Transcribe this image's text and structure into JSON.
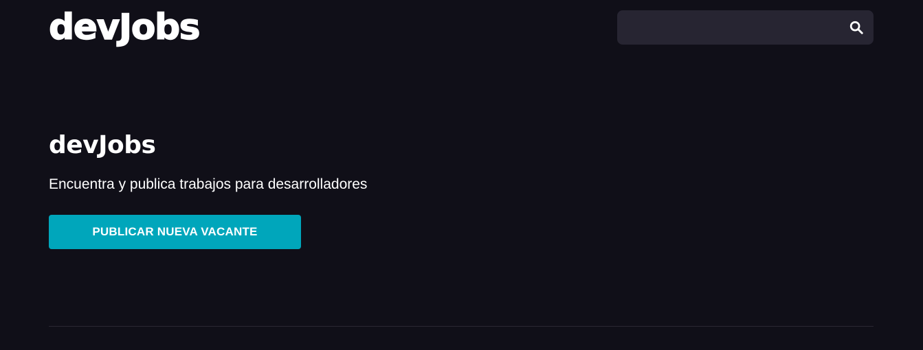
{
  "header": {
    "logo": "devJobs",
    "search": {
      "placeholder": "",
      "value": "",
      "icon": "search-icon"
    }
  },
  "hero": {
    "title": "devJobs",
    "subtitle": "Encuentra y publica trabajos para desarrolladores",
    "cta_label": "PUBLICAR NUEVA VACANTE"
  },
  "colors": {
    "background": "#100f18",
    "search_bg": "#272532",
    "accent": "#00a6bb",
    "text": "#ffffff",
    "divider": "#2a2833"
  }
}
